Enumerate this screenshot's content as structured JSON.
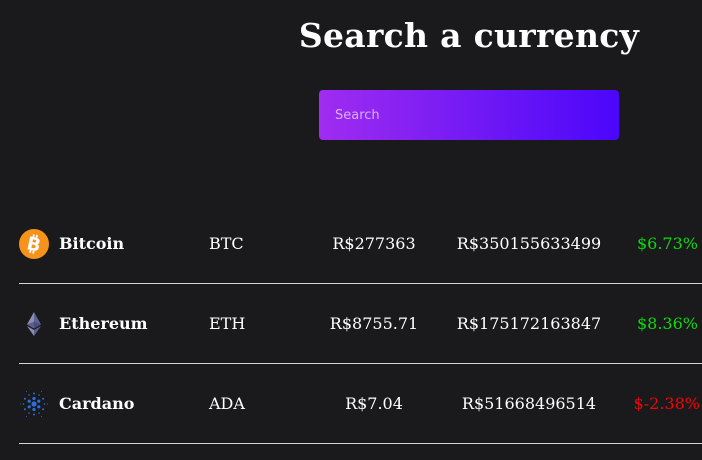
{
  "header": {
    "title": "Search a currency"
  },
  "search": {
    "placeholder": "Search",
    "value": ""
  },
  "colors": {
    "background": "#1a1a1c",
    "search_gradient_start": "#a02cf0",
    "search_gradient_end": "#4b06fb",
    "positive": "#11d811",
    "negative": "#f00606",
    "divider": "#d6d6d6"
  },
  "coins": [
    {
      "icon": "bitcoin-icon",
      "name": "Bitcoin",
      "symbol": "BTC",
      "price": "R$277363",
      "volume": "R$350155633499",
      "change": "$6.73%",
      "trend": "up"
    },
    {
      "icon": "ethereum-icon",
      "name": "Ethereum",
      "symbol": "ETH",
      "price": "R$8755.71",
      "volume": "R$175172163847",
      "change": "$8.36%",
      "trend": "up"
    },
    {
      "icon": "cardano-icon",
      "name": "Cardano",
      "symbol": "ADA",
      "price": "R$7.04",
      "volume": "R$51668496514",
      "change": "$-2.38%",
      "trend": "down"
    }
  ]
}
